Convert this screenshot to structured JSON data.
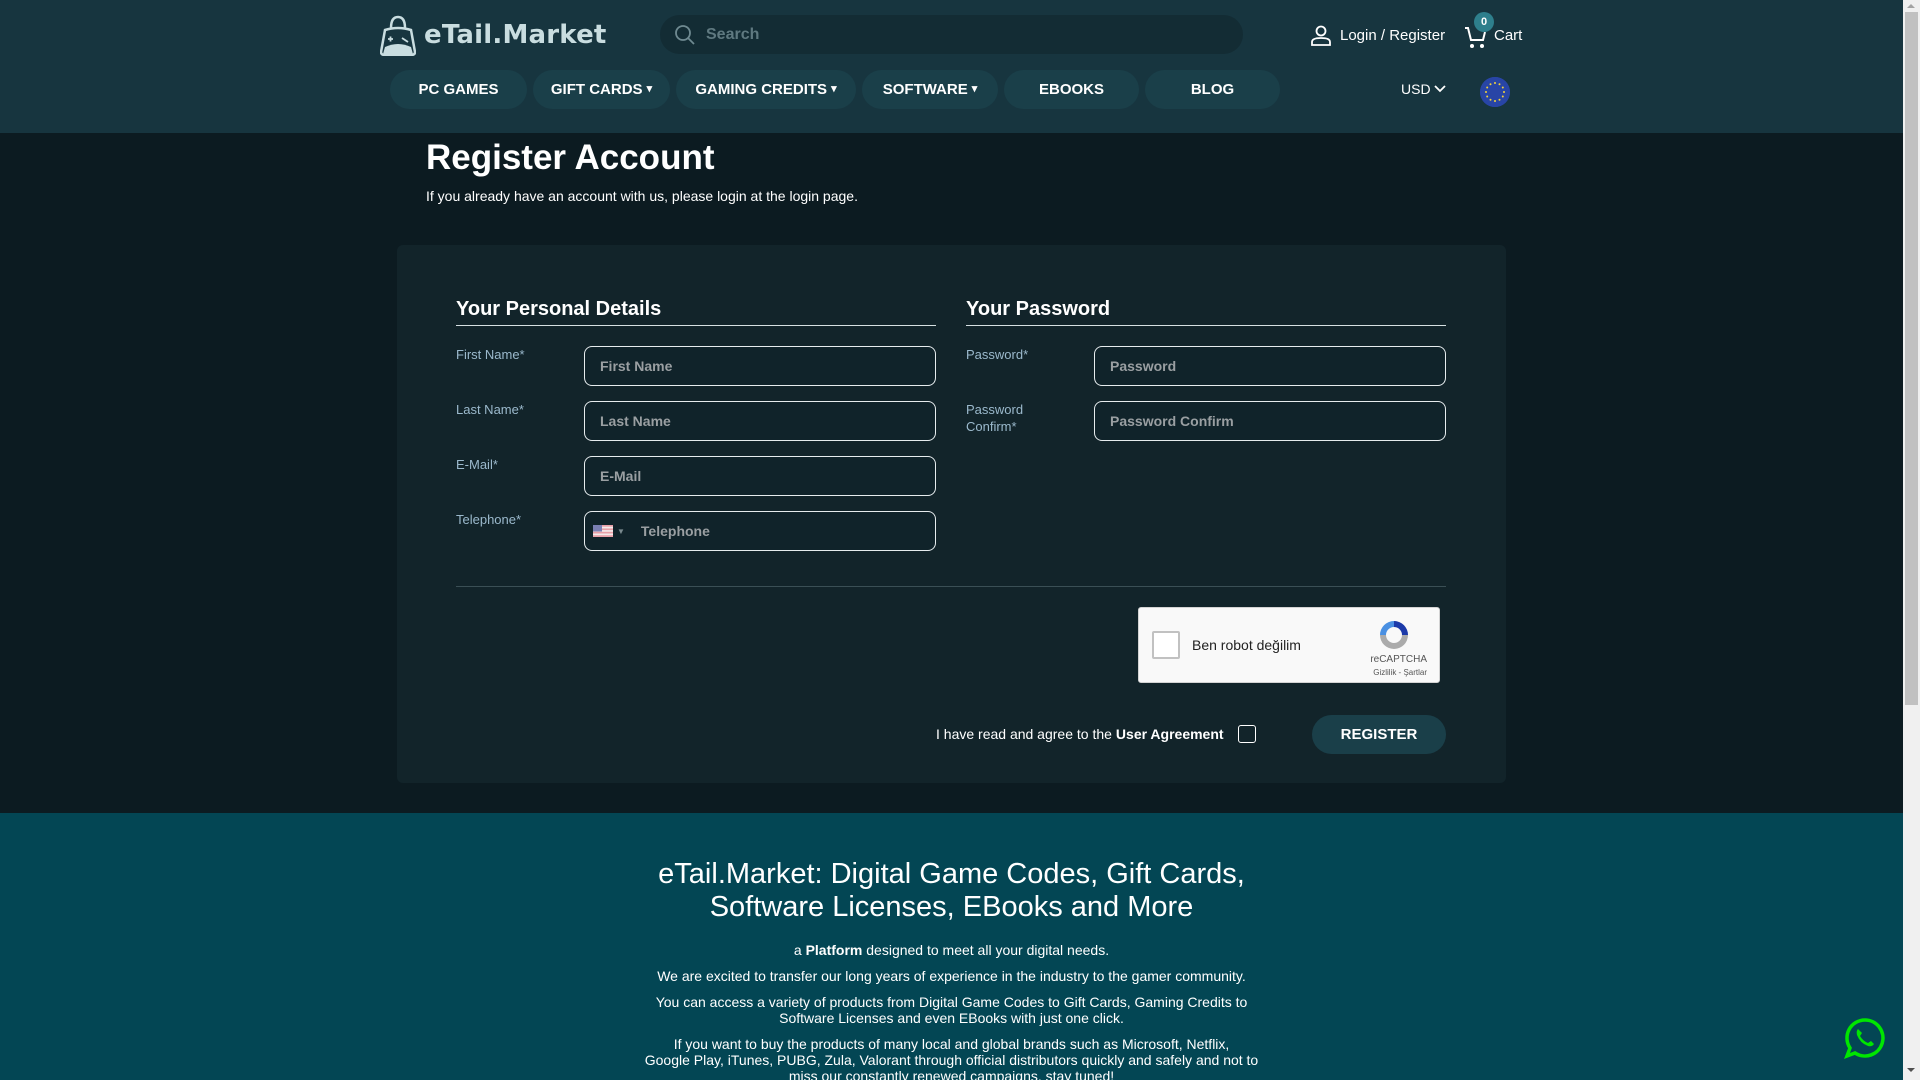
{
  "header": {
    "logo_text": "eTail.Market",
    "search_placeholder": "Search",
    "login_label": "Login / Register",
    "cart_label": "Cart",
    "cart_count": "0",
    "currency": "USD",
    "nav": [
      {
        "label": "PC GAMES",
        "dropdown": false
      },
      {
        "label": "GIFT CARDS",
        "dropdown": true
      },
      {
        "label": "GAMING CREDITS",
        "dropdown": true
      },
      {
        "label": "SOFTWARE",
        "dropdown": true
      },
      {
        "label": "EBOOKS",
        "dropdown": false
      },
      {
        "label": "BLOG",
        "dropdown": false
      }
    ],
    "chevron_glyph": "»"
  },
  "main": {
    "title": "Register Account",
    "subtitle": "If you already have an account with us, please login at the login page.",
    "personal": {
      "heading": "Your Personal Details",
      "fields": [
        {
          "label": "First Name*",
          "placeholder": "First Name"
        },
        {
          "label": "Last Name*",
          "placeholder": "Last Name"
        },
        {
          "label": "E-Mail*",
          "placeholder": "E-Mail"
        },
        {
          "label": "Telephone*",
          "placeholder": "Telephone",
          "country": "US"
        }
      ]
    },
    "password": {
      "heading": "Your Password",
      "fields": [
        {
          "label": "Password*",
          "placeholder": "Password"
        },
        {
          "label": "Password Confirm*",
          "label_line1": "Password",
          "label_line2": "Confirm*",
          "placeholder": "Password Confirm"
        }
      ]
    },
    "captcha": {
      "text": "Ben robot değilim",
      "brand": "reCAPTCHA",
      "links": "Gizlilik - Şartlar"
    },
    "agreement": {
      "prefix": "I have read and agree to the",
      "link": "User Agreement"
    },
    "register_label": "REGISTER"
  },
  "footer": {
    "heading_line1": "eTail.Market: Digital Game Codes, Gift Cards,",
    "heading_line2": "Software Licenses, EBooks and More",
    "tagline_prefix": "a",
    "tagline_bold": "Platform",
    "tagline_suffix": "designed to meet all your digital needs.",
    "p1": "We are excited to transfer our long years of experience in the industry to the gamer community.",
    "p2_line1": "You can access a variety of products from Digital Game Codes to Gift Cards, Gaming Credits to",
    "p2_line2": "Software Licenses and even EBooks with just one click.",
    "p3_line1": "If you want to buy the products of many local and global brands such as Microsoft, Netflix,",
    "p3_line2": "Google Play, iTunes, PUBG, Zula, Valorant through official distributors quickly and safely and not to",
    "p3_line3": "miss our constantly renewed campaigns, stay tuned!"
  },
  "colors": {
    "header_bg": "#17353f",
    "page_bg": "#0c1b21",
    "card_bg": "#12242a",
    "nav_button_bg": "#1a3f49",
    "footer_bg": "#034654",
    "label_color": "#9bb9cc",
    "whatsapp_green": "#00e600"
  }
}
